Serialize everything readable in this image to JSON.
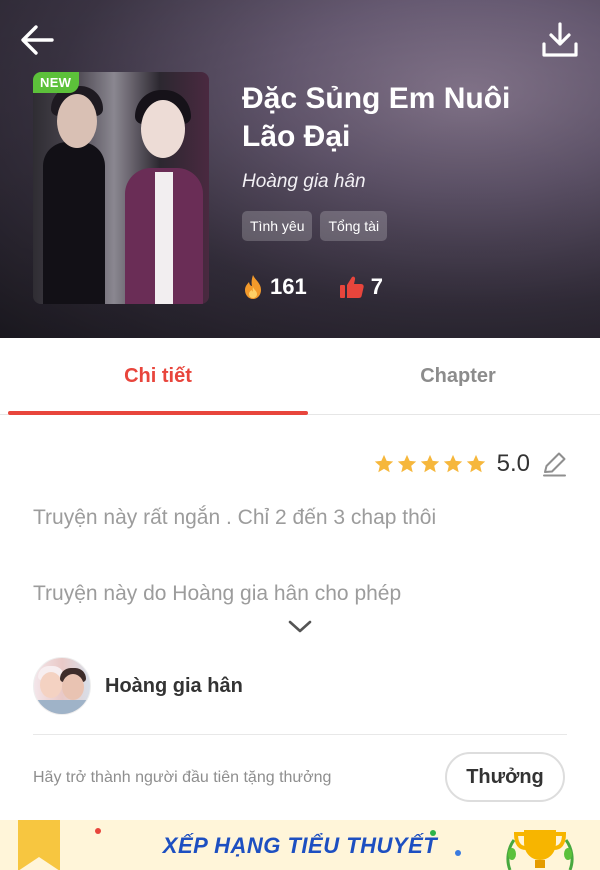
{
  "header": {
    "new_badge": "NEW",
    "title": "Đặc Sủng Em Nuôi Lão Đại",
    "author": "Hoàng gia hân",
    "tags": [
      "Tình yêu",
      "Tổng tài"
    ],
    "views": "161",
    "likes": "7"
  },
  "tabs": [
    "Chi tiết",
    "Chapter"
  ],
  "rating": {
    "value": "5.0",
    "stars": 5
  },
  "description": [
    "Truyện này rất ngắn . Chỉ 2 đến 3 chap thôi",
    "Truyện này do Hoàng gia hân cho phép"
  ],
  "author_row": {
    "name": "Hoàng gia hân"
  },
  "reward": {
    "prompt": "Hãy trở thành người đầu tiên tặng thưởng",
    "button": "Thưởng"
  },
  "banner": {
    "text": "XẾP HẠNG TIỂU THUYẾT"
  },
  "colors": {
    "accent": "#e8453c",
    "star": "#f6b73c",
    "banner_text": "#1d4fc1"
  }
}
